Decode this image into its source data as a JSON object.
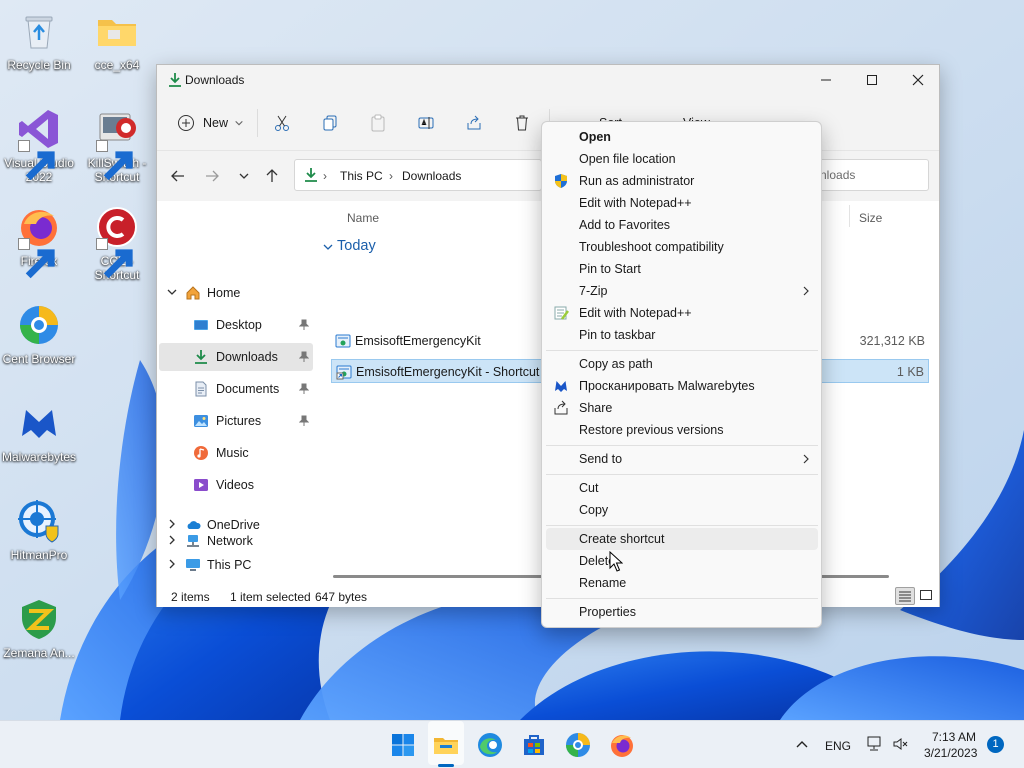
{
  "desktop": {
    "icons": [
      {
        "label": "Recycle Bin",
        "icon": "recycle-bin-icon"
      },
      {
        "label": "cce_x64",
        "icon": "folder-icon"
      },
      {
        "label": "Visual Studio 2022",
        "icon": "visual-studio-icon"
      },
      {
        "label": "KillSwitch - Shortcut",
        "icon": "killswitch-icon"
      },
      {
        "label": "Firefox",
        "icon": "firefox-icon"
      },
      {
        "label": "CCE - Shortcut",
        "icon": "comodo-cce-icon"
      },
      {
        "label": "Cent Browser",
        "icon": "cent-browser-icon"
      },
      {
        "label": "Malwarebytes",
        "icon": "malwarebytes-icon"
      },
      {
        "label": "HitmanPro",
        "icon": "hitmanpro-icon"
      },
      {
        "label": "Zemana An...",
        "icon": "zemana-icon"
      }
    ]
  },
  "explorer": {
    "title": "Downloads",
    "toolbar": {
      "new_label": "New",
      "sort_label": "Sort",
      "view_label": "View",
      "more_label": "..."
    },
    "address": {
      "crumbs": [
        "This PC",
        "Downloads"
      ]
    },
    "search": {
      "placeholder": "nloads"
    },
    "nav_pane": {
      "home": "Home",
      "pinned": [
        "Desktop",
        "Downloads",
        "Documents",
        "Pictures"
      ],
      "unpinned": [
        "Music",
        "Videos"
      ],
      "onedrive": "OneDrive",
      "this_pc": "This PC",
      "network": "Network"
    },
    "columns": {
      "name": "Name",
      "size": "Size"
    },
    "group_label": "Today",
    "files": [
      {
        "name": "EmsisoftEmergencyKit",
        "size": "321,312 KB",
        "selected": false
      },
      {
        "name": "EmsisoftEmergencyKit - Shortcut",
        "size": "1 KB",
        "selected": true
      }
    ],
    "status": {
      "items": "2 items",
      "selection": "1 item selected",
      "bytes": "647 bytes"
    }
  },
  "context_menu": {
    "groups": [
      [
        {
          "label": "Open",
          "bold": true
        },
        {
          "label": "Open file location"
        },
        {
          "label": "Run as administrator",
          "icon": "uac-shield-icon"
        },
        {
          "label": "Edit with Notepad++"
        },
        {
          "label": "Add to Favorites"
        },
        {
          "label": "Troubleshoot compatibility"
        },
        {
          "label": "Pin to Start"
        },
        {
          "label": "7-Zip",
          "submenu": true
        },
        {
          "label": "Edit with Notepad++",
          "icon": "notepadpp-icon"
        },
        {
          "label": "Pin to taskbar"
        }
      ],
      [
        {
          "label": "Copy as path"
        },
        {
          "label": "Просканировать Malwarebytes",
          "icon": "malwarebytes-icon"
        },
        {
          "label": "Share",
          "icon": "share-icon"
        },
        {
          "label": "Restore previous versions"
        }
      ],
      [
        {
          "label": "Send to",
          "submenu": true
        }
      ],
      [
        {
          "label": "Cut"
        },
        {
          "label": "Copy"
        }
      ],
      [
        {
          "label": "Create shortcut",
          "hover": true
        },
        {
          "label": "Delete"
        },
        {
          "label": "Rename"
        }
      ],
      [
        {
          "label": "Properties"
        }
      ]
    ]
  },
  "taskbar": {
    "apps": [
      "start-icon",
      "file-explorer-icon",
      "edge-icon",
      "store-icon",
      "cent-browser-icon",
      "firefox-icon"
    ],
    "tray": {
      "language": "ENG",
      "time": "7:13 AM",
      "date": "3/21/2023",
      "notifications": "1"
    }
  },
  "colors": {
    "accent": "#0067c0",
    "selection": "#cce4f7",
    "group_header": "#1b5fab"
  }
}
